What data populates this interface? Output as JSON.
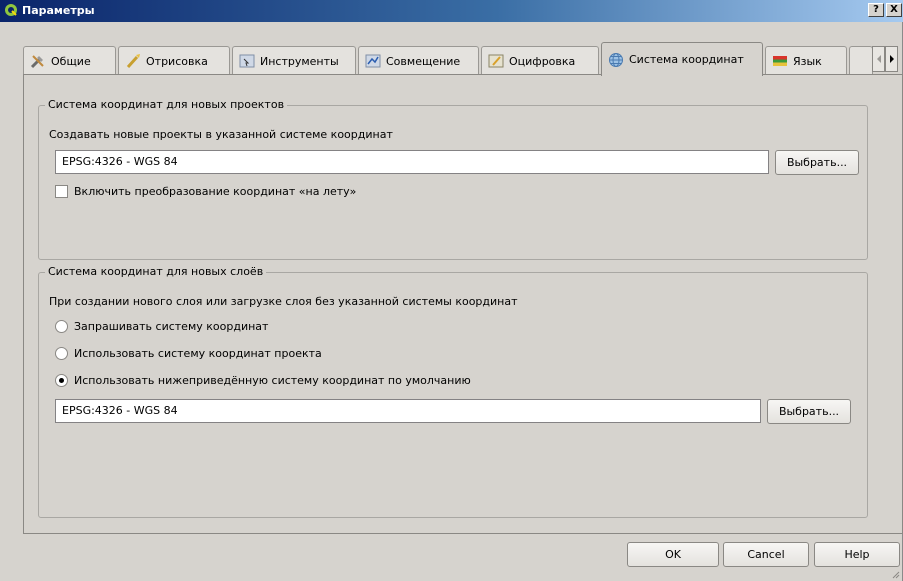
{
  "window": {
    "title": "Параметры",
    "help_label": "?",
    "close_label": "X"
  },
  "tabs": [
    {
      "label": "Общие",
      "icon": "tools-icon"
    },
    {
      "label": "Отрисовка",
      "icon": "brush-icon"
    },
    {
      "label": "Инструменты",
      "icon": "map-tools-icon"
    },
    {
      "label": "Совмещение",
      "icon": "snapping-icon"
    },
    {
      "label": "Оцифровка",
      "icon": "digitizing-icon"
    },
    {
      "label": "Система координат",
      "icon": "globe-icon"
    },
    {
      "label": "Язык",
      "icon": "flag-icon"
    }
  ],
  "active_tab": "Система координат",
  "projects_group": {
    "title": "Система координат для новых проектов",
    "description": "Создавать новые проекты в указанной системе координат",
    "crs_value": "EPSG:4326 - WGS 84",
    "select_button": "Выбрать...",
    "otf_checkbox_label": "Включить преобразование координат «на лету»",
    "otf_checked": false
  },
  "layers_group": {
    "title": "Система координат для новых слоёв",
    "description": "При создании нового слоя или загрузке слоя без указанной системы координат",
    "options": [
      {
        "label": "Запрашивать систему координат",
        "checked": false
      },
      {
        "label": "Использовать систему координат проекта",
        "checked": false
      },
      {
        "label": "Использовать нижеприведённую систему координат по умолчанию",
        "checked": true
      }
    ],
    "crs_value": "EPSG:4326 - WGS 84",
    "select_button": "Выбрать..."
  },
  "footer": {
    "ok_label": "OK",
    "cancel_label": "Cancel",
    "help_label": "Help"
  },
  "colors": {
    "titlebar_start": "#0a246a",
    "titlebar_end": "#a6caf0",
    "dialog_bg": "#d6d3ce"
  }
}
